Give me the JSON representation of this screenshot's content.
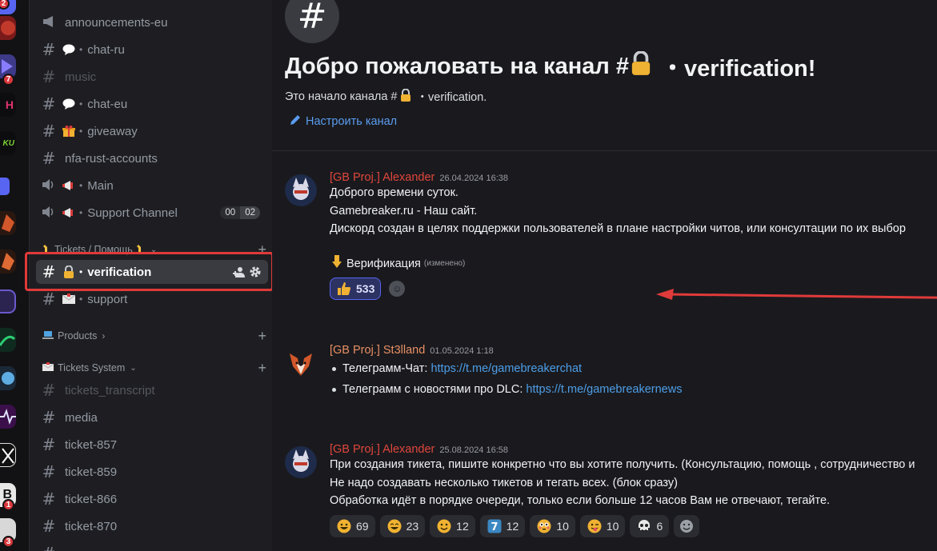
{
  "rail": {
    "badges": [
      "2",
      "7",
      "1",
      "3"
    ],
    "tags": [
      "H",
      "KU",
      "B"
    ]
  },
  "sidebar": {
    "channels": [
      {
        "id": "announcements-eu",
        "label": "announcements-eu",
        "kind": "announce",
        "emoji": ""
      },
      {
        "id": "chat-ru",
        "label": "chat-ru",
        "kind": "text",
        "emoji": "speech-bubble"
      },
      {
        "id": "music",
        "label": "music",
        "kind": "text",
        "emoji": "",
        "muted": true
      },
      {
        "id": "chat-eu",
        "label": "chat-eu",
        "kind": "text",
        "emoji": "speech-bubble"
      },
      {
        "id": "giveaway",
        "label": "giveaway",
        "kind": "text",
        "emoji": "gift"
      },
      {
        "id": "nfa-rust-accounts",
        "label": "nfa-rust-accounts",
        "kind": "text",
        "emoji": ""
      },
      {
        "id": "main",
        "label": "Main",
        "kind": "voice",
        "emoji": "megaphone"
      },
      {
        "id": "support-channel",
        "label": "Support Channel",
        "kind": "voice",
        "emoji": "megaphone",
        "count_a": "00",
        "count_b": "02"
      }
    ],
    "category_tickets": "Tickets / Помощь",
    "channels_tickets": [
      {
        "id": "verification",
        "label": "verification",
        "emoji": "lock"
      },
      {
        "id": "support",
        "label": "support",
        "emoji": "envelope"
      }
    ],
    "category_products": "Products",
    "category_tickets_system": "Tickets System",
    "channels_bottom": [
      {
        "id": "tickets_transcript",
        "label": "tickets_transcript",
        "muted": true
      },
      {
        "id": "media",
        "label": "media"
      },
      {
        "id": "ticket-857",
        "label": "ticket-857"
      },
      {
        "id": "ticket-859",
        "label": "ticket-859"
      },
      {
        "id": "ticket-866",
        "label": "ticket-866"
      },
      {
        "id": "ticket-870",
        "label": "ticket-870"
      }
    ]
  },
  "main": {
    "welcome_title_a": "Добро пожаловать на канал #",
    "welcome_title_b": "・verification!",
    "welcome_sub_a": "Это начало канала #",
    "welcome_sub_b": "・verification.",
    "setup_link": "Настроить канал",
    "messages": [
      {
        "author": "[GB Proj.] Alexander",
        "timestamp": "26.04.2024 16:38",
        "lines": [
          "Доброго времени суток.",
          "Gamebreaker.ru - Наш сайт.",
          "Дискорд создан в целях поддержки пользователей в плане настройки читов, или консултации по их выбор"
        ],
        "verification_label": "Верификация",
        "edited": "(изменено)",
        "reaction_count": "533"
      },
      {
        "author": "[GB Proj.] St3lland",
        "timestamp": "01.05.2024 1:18",
        "bullets": [
          {
            "text": "Телеграмм-Чат: ",
            "link": "https://t.me/gamebreakerchat"
          },
          {
            "text": "Телеграмм с новостями про DLC: ",
            "link": "https://t.me/gamebreakernews"
          }
        ]
      },
      {
        "author": "[GB Proj.] Alexander",
        "timestamp": "25.08.2024 16:58",
        "lines": [
          "При создания тикета, пишите конкретно что вы хотите получить. (Консультацию, помощь , сотрудничество и",
          "Не надо создавать несколько тикетов и тегать всех. (блок сразу)",
          "Обработка идёт в порядке очереди, только если больше 12 часов Вам не отвечают, тегайте."
        ],
        "reactions": [
          {
            "emoji": "grinning-face",
            "count": "69"
          },
          {
            "emoji": "laughing-face",
            "count": "23"
          },
          {
            "emoji": "smiling-face",
            "count": "12"
          },
          {
            "emoji": "keycap-7",
            "count": "12"
          },
          {
            "emoji": "flushed-face",
            "count": "10"
          },
          {
            "emoji": "winking-tongue-face",
            "count": "10"
          },
          {
            "emoji": "skull",
            "count": "6"
          }
        ]
      }
    ]
  },
  "colors": {
    "accent_link": "#4d9ee8",
    "author_red": "#e0463c",
    "author_orange": "#e98f63",
    "highlight_box": "#e03a3a"
  }
}
